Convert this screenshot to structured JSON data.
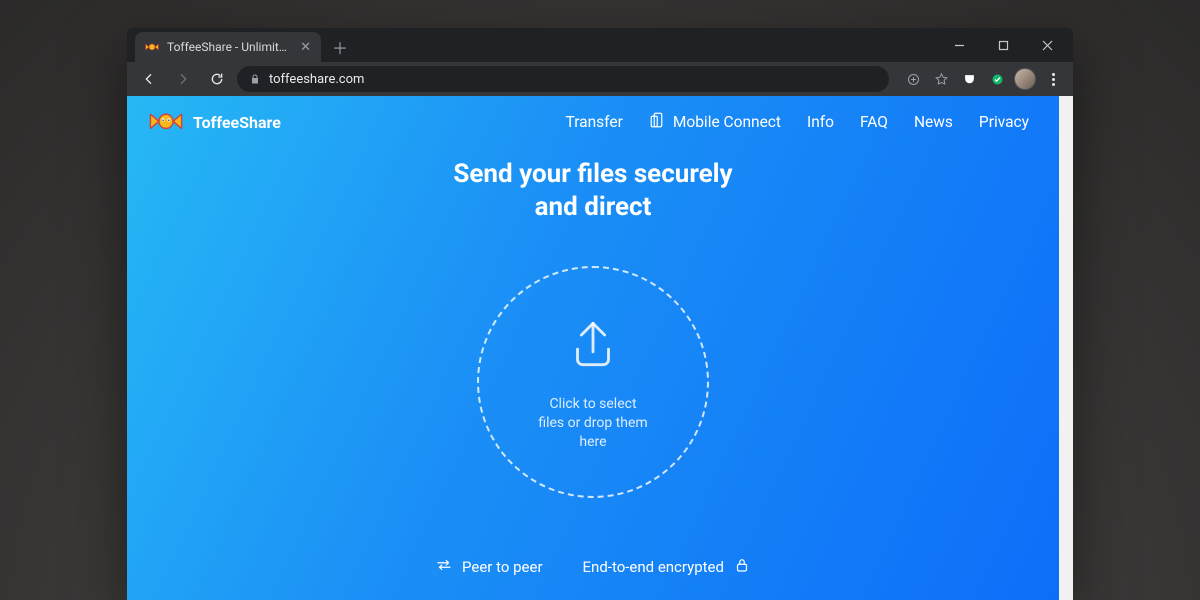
{
  "browser": {
    "tab_title": "ToffeeShare - Unlimited and sec…",
    "url": "toffeeshare.com"
  },
  "brand": {
    "name": "ToffeeShare"
  },
  "nav": {
    "transfer": "Transfer",
    "mobile_connect": "Mobile Connect",
    "info": "Info",
    "faq": "FAQ",
    "news": "News",
    "privacy": "Privacy"
  },
  "headline_line1": "Send your files securely",
  "headline_line2": "and direct",
  "dropzone": {
    "line1": "Click to select",
    "line2": "files or drop them",
    "line3": "here"
  },
  "features": {
    "p2p": "Peer to peer",
    "e2e": "End-to-end encrypted"
  }
}
